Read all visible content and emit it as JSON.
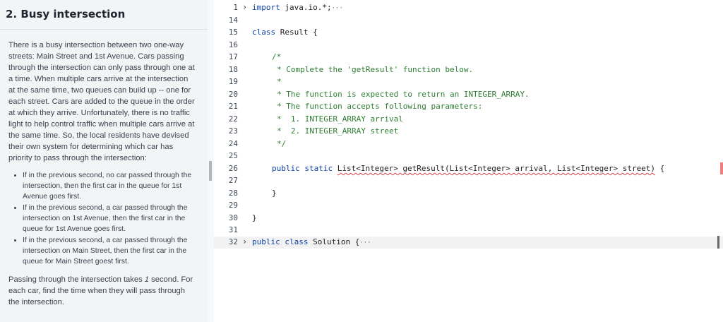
{
  "problem": {
    "title": "2. Busy intersection",
    "intro": "There is a busy intersection between two one-way streets: Main Street and 1st Avenue. Cars passing through the intersection can only pass through one at a time. When multiple cars arrive at the intersection at the same time, two queues can build up -- one for each street. Cars are added to the queue in the order at which they arrive. Unfortunately, there is no traffic light to help control traffic when multiple cars arrive at the same time. So, the local residents have devised their own system for determining which car has priority to pass through the intersection:",
    "rules": [
      "If in the previous second, no car passed through the intersection, then the first car in the queue for 1st Avenue goes first.",
      "If in the previous second, a car passed through the intersection on 1st Avenue, then the first car in the queue for 1st Avenue goes first.",
      "If in the previous second, a car passed through the intersection on Main Street, then the first car in the queue for Main Street goest first."
    ],
    "outro_pre": "Passing through the intersection takes ",
    "outro_em": "1",
    "outro_post": " second. For each car, find the time when they will pass through the intersection."
  },
  "editor": {
    "line_numbers": [
      "1",
      "14",
      "15",
      "16",
      "17",
      "18",
      "19",
      "20",
      "21",
      "22",
      "23",
      "24",
      "25",
      "26",
      "27",
      "28",
      "29",
      "30",
      "31",
      "32"
    ],
    "import_kw": "import",
    "import_rest": " java.io.*;",
    "class_kw": "class",
    "class_name": " Result {",
    "comment_open": "/*",
    "comment_lines": [
      "* Complete the 'getResult' function below.",
      "*",
      "* The function is expected to return an INTEGER_ARRAY.",
      "* The function accepts following parameters:",
      "*  1. INTEGER_ARRAY arrival",
      "*  2. INTEGER_ARRAY street"
    ],
    "comment_close": "*/",
    "method_kw": "public static",
    "method_sig": "List<Integer> getResult(List<Integer> arrival, List<Integer> street)",
    "method_brace": " {",
    "close_brace": "}",
    "solution_kw": "public class",
    "solution_name": " Solution {",
    "fold_dots": "···"
  }
}
